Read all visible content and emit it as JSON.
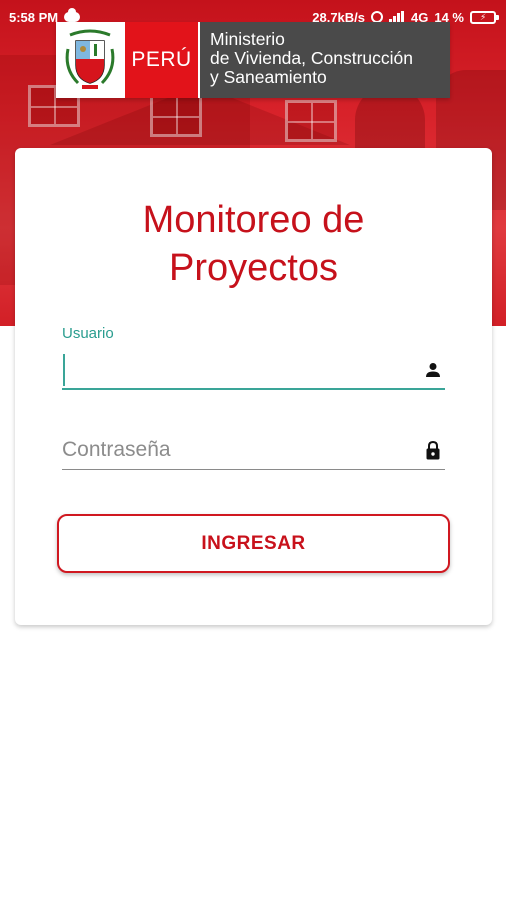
{
  "status_bar": {
    "time": "5:58 PM",
    "network_speed": "28.7kB/s",
    "network_type": "4G",
    "battery": "14 %",
    "icons": [
      "cloud-icon",
      "alarm-icon",
      "signal-icon",
      "battery-charging-icon"
    ]
  },
  "brand": {
    "country": "PERÚ",
    "ministry_lines": [
      "Ministerio",
      "de Vivienda, Construcción",
      "y Saneamiento"
    ],
    "emblem_icon": "peru-coat-of-arms-icon",
    "colors": {
      "red": "#e2131a",
      "gray": "#4a4a4a"
    }
  },
  "login": {
    "title": "Monitoreo de Proyectos",
    "username_label": "Usuario",
    "username_value": "",
    "username_icon": "person-icon",
    "password_placeholder": "Contraseña",
    "password_icon": "lock-icon",
    "submit_label": "INGRESAR",
    "accent_color": "#c8111b",
    "focus_color": "#2a9d8f"
  }
}
